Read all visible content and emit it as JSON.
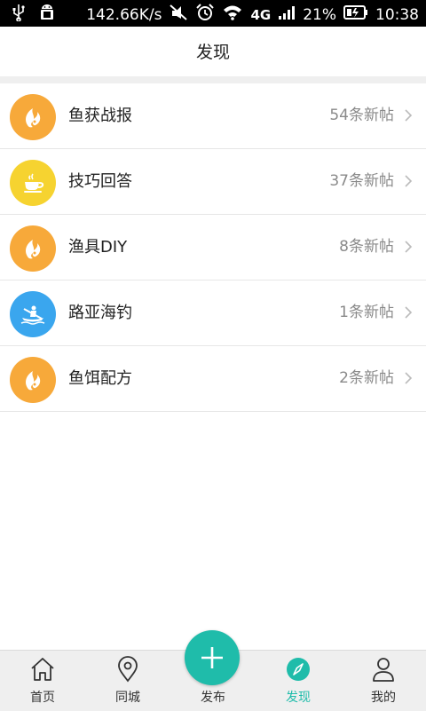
{
  "status_bar": {
    "speed": "142.66K/s",
    "network": "4G",
    "battery": "21%",
    "time": "10:38"
  },
  "header": {
    "title": "发现"
  },
  "list": [
    {
      "label": "鱼获战报",
      "count": "54条新帖",
      "icon": "fish-icon",
      "color": "#f7a93a"
    },
    {
      "label": "技巧回答",
      "count": "37条新帖",
      "icon": "cup-icon",
      "color": "#f6d330"
    },
    {
      "label": "渔具DIY",
      "count": "8条新帖",
      "icon": "fish-icon",
      "color": "#f7a93a"
    },
    {
      "label": "路亚海钓",
      "count": "1条新帖",
      "icon": "kayak-icon",
      "color": "#3aa6ee"
    },
    {
      "label": "鱼饵配方",
      "count": "2条新帖",
      "icon": "fish-icon",
      "color": "#f7a93a"
    }
  ],
  "bottom_nav": {
    "home": "首页",
    "city": "同城",
    "publish": "发布",
    "discover": "发现",
    "mine": "我的"
  },
  "colors": {
    "accent": "#1fbcaa"
  }
}
